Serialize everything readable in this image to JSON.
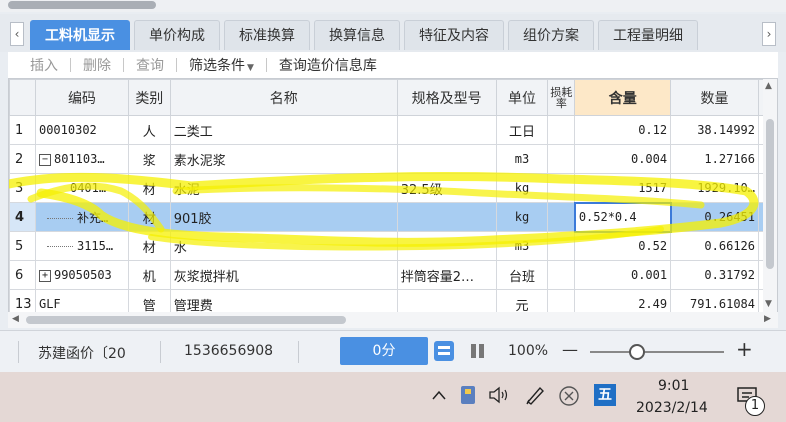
{
  "tabs": [
    {
      "label": "工料机显示",
      "active": true
    },
    {
      "label": "单价构成"
    },
    {
      "label": "标准换算"
    },
    {
      "label": "换算信息"
    },
    {
      "label": "特征及内容"
    },
    {
      "label": "组价方案"
    },
    {
      "label": "工程量明细"
    }
  ],
  "toolbar": {
    "insert": "插入",
    "delete": "删除",
    "query": "查询",
    "filter": "筛选条件",
    "price_db": "查询造价信息库"
  },
  "grid": {
    "headers": {
      "code": "编码",
      "type": "类别",
      "name": "名称",
      "spec": "规格及型号",
      "unit": "单位",
      "lossrate": "损耗率",
      "content": "含量",
      "quantity": "数量"
    },
    "rows": [
      {
        "num": "1",
        "code": "00010302",
        "type": "人",
        "name": "二类工",
        "spec": "",
        "unit": "工日",
        "content": "0.12",
        "quantity": "38.14992"
      },
      {
        "num": "2",
        "code": "801103…",
        "type": "浆",
        "name": "素水泥浆",
        "spec": "",
        "unit": "m3",
        "content": "0.004",
        "quantity": "1.27166"
      },
      {
        "num": "3",
        "code": "0401…",
        "type": "材",
        "name": "水泥",
        "spec": "32.5级",
        "unit": "kg",
        "content": "1517",
        "quantity": "1929.10…"
      },
      {
        "num": "4",
        "code": "补充…",
        "type": "材",
        "name": "901胶",
        "spec": "",
        "unit": "kg",
        "content": "0.52*0.4",
        "quantity": "0.26451"
      },
      {
        "num": "5",
        "code": "3115…",
        "type": "材",
        "name": "水",
        "spec": "",
        "unit": "m3",
        "content": "0.52",
        "quantity": "0.66126"
      },
      {
        "num": "6",
        "code": "99050503",
        "type": "机",
        "name": "灰浆搅拌机",
        "spec": "拌筒容量2…",
        "unit": "台班",
        "content": "0.001",
        "quantity": "0.31792"
      },
      {
        "num": "13",
        "code": "GLF",
        "type": "管",
        "name": "管理费",
        "spec": "",
        "unit": "元",
        "content": "2.49",
        "quantity": "791.61084"
      }
    ]
  },
  "status": {
    "doc_name": "苏建函价〔20",
    "phone": "1536656908",
    "score": "0分",
    "zoom": "100%",
    "zoom_minus": "—",
    "zoom_plus": "+"
  },
  "taskbar": {
    "time": "9:01",
    "date": "2023/2/14",
    "ime": "五",
    "notif_count": "1"
  },
  "colors": {
    "accent": "#4a90e2",
    "highlight_marker": "#f5f000",
    "selected_row": "#a8cdf2"
  }
}
